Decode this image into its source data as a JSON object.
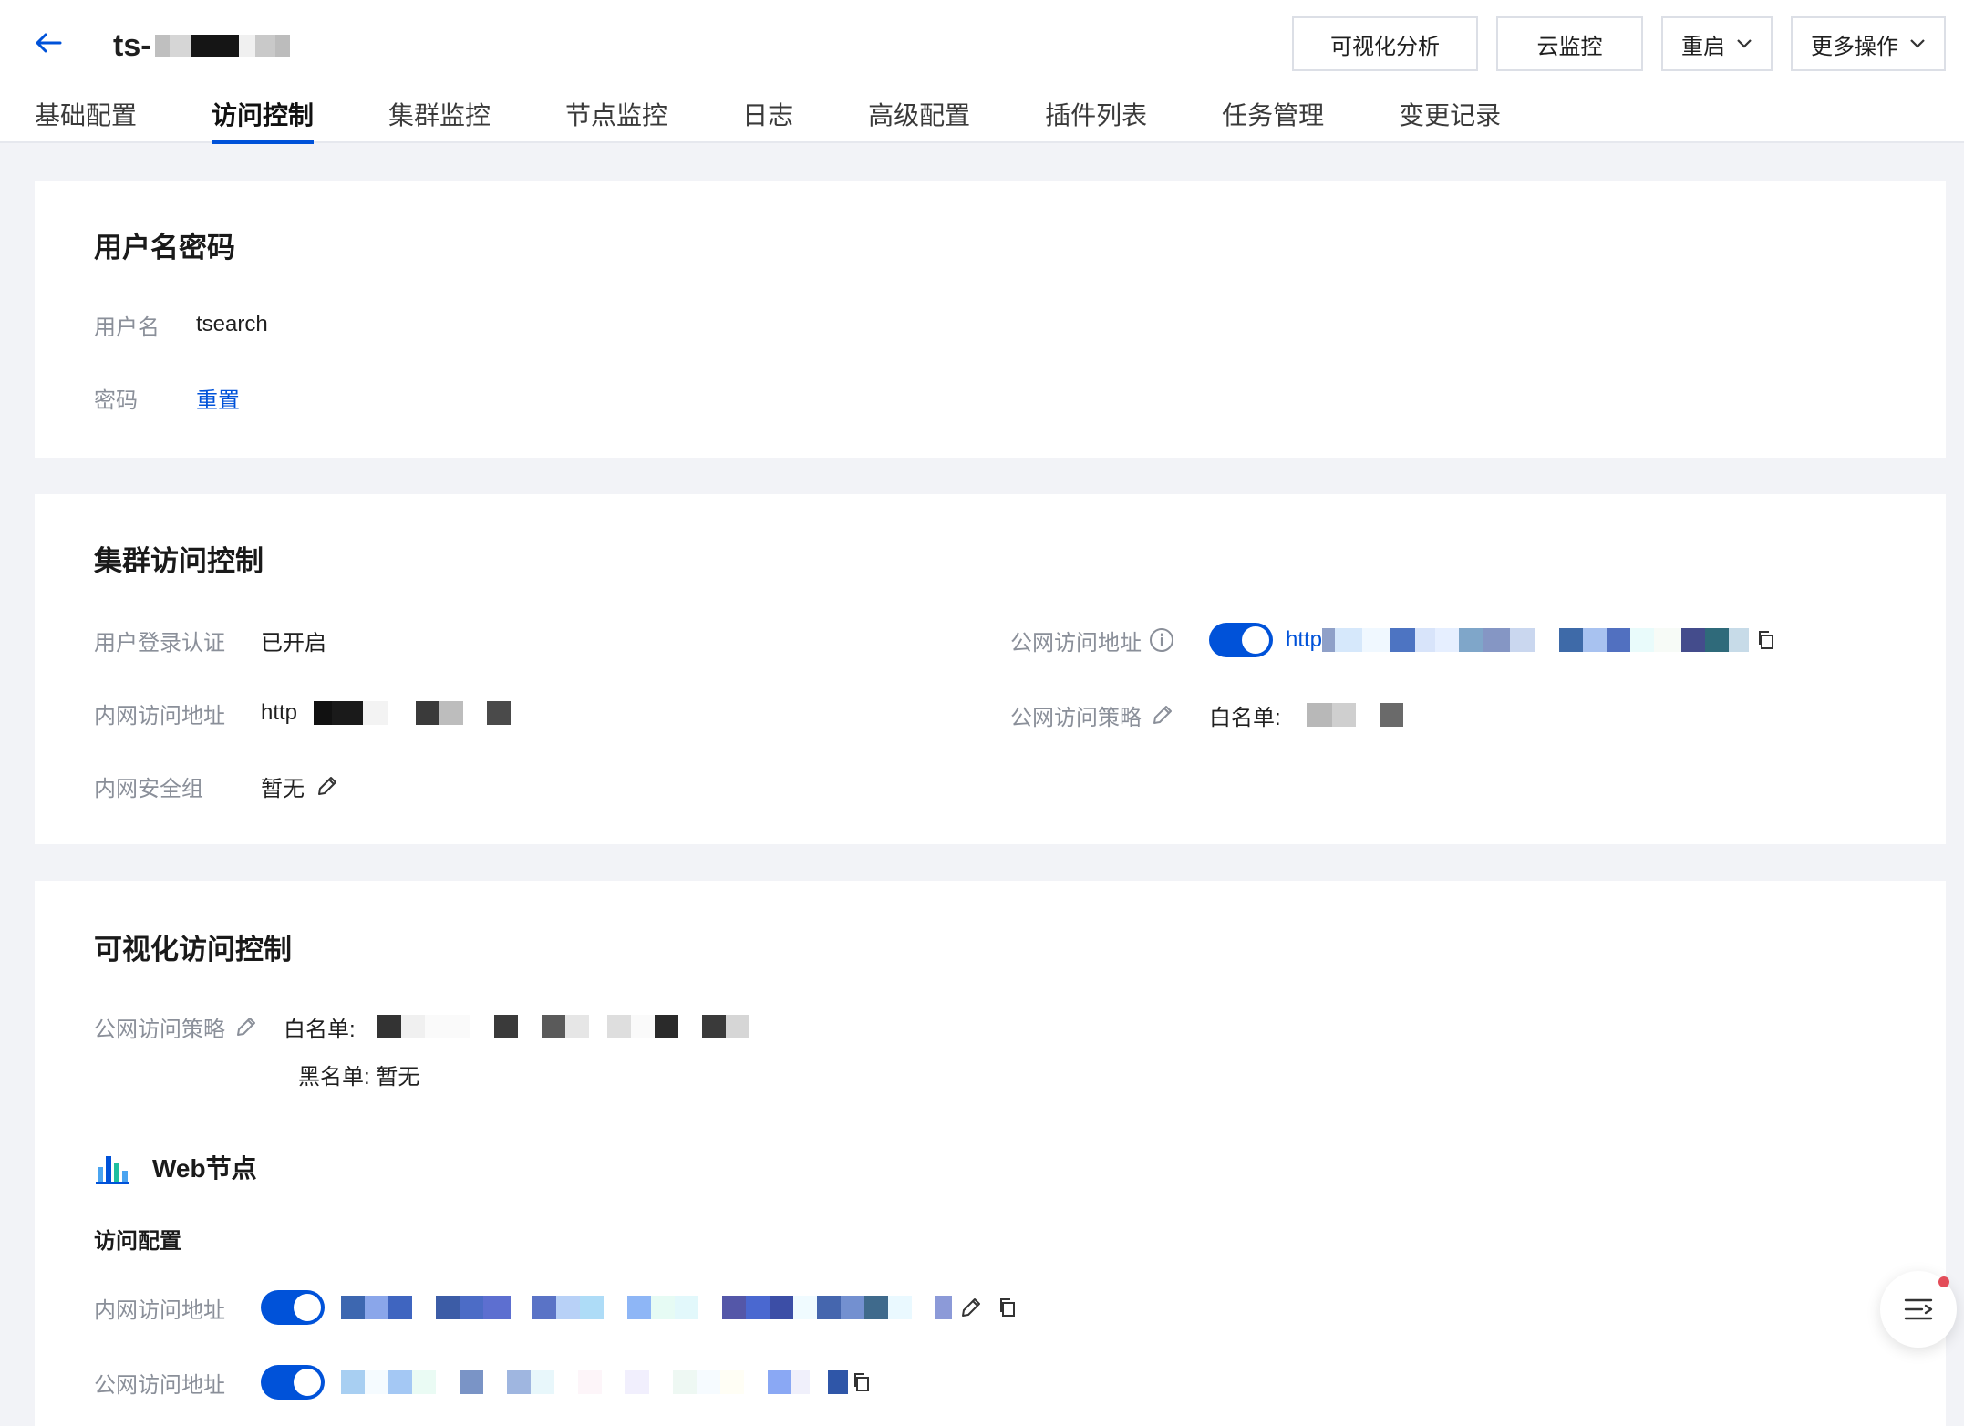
{
  "header": {
    "title": "ts-",
    "actions": {
      "visual_analysis": "可视化分析",
      "cloud_monitor": "云监控",
      "restart": "重启",
      "more_actions": "更多操作"
    },
    "tabs": [
      {
        "label": "基础配置"
      },
      {
        "label": "访问控制",
        "active": true
      },
      {
        "label": "集群监控"
      },
      {
        "label": "节点监控"
      },
      {
        "label": "日志"
      },
      {
        "label": "高级配置"
      },
      {
        "label": "插件列表"
      },
      {
        "label": "任务管理"
      },
      {
        "label": "变更记录"
      }
    ]
  },
  "credentials": {
    "title": "用户名密码",
    "username_label": "用户名",
    "username_value": "tsearch",
    "password_label": "密码",
    "reset_link": "重置"
  },
  "cluster_access": {
    "title": "集群访问控制",
    "auth_label": "用户登录认证",
    "auth_value": "已开启",
    "private_addr_label": "内网访问地址",
    "private_addr_prefix": "http",
    "security_group_label": "内网安全组",
    "security_group_value": "暂无",
    "public_addr_label": "公网访问地址",
    "public_addr_prefix": "http",
    "public_policy_label": "公网访问策略",
    "whitelist_label": "白名单:"
  },
  "visual_access": {
    "title": "可视化访问控制",
    "public_policy_label": "公网访问策略",
    "whitelist_label": "白名单:",
    "blacklist_text": "黑名单: 暂无",
    "web_node_title": "Web节点",
    "access_config_title": "访问配置",
    "private_addr_label": "内网访问地址",
    "public_addr_label": "公网访问地址"
  },
  "colors": {
    "primary": "#0052d9",
    "notification_dot": "#e34d59",
    "page_bg": "#f2f3f7"
  },
  "icons": {
    "back": "arrow-left-icon",
    "chevron": "chevron-down-icon",
    "info": "info-circle-icon",
    "edit": "pencil-icon",
    "copy": "copy-icon",
    "chart": "bar-chart-icon",
    "menu": "list-menu-icon"
  }
}
